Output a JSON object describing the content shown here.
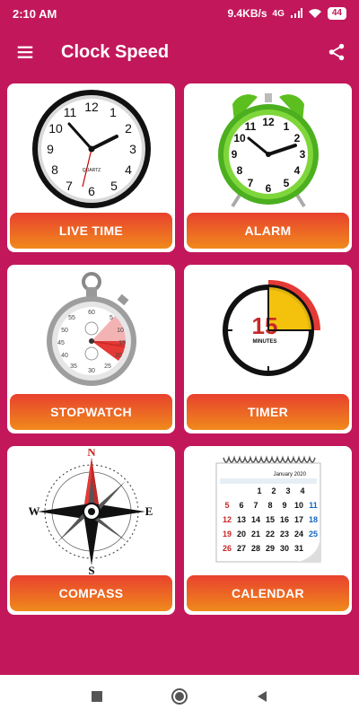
{
  "status": {
    "time": "2:10 AM",
    "speed": "9.4KB/s",
    "network": "4G",
    "battery": "44"
  },
  "app_bar": {
    "title": "Clock Speed",
    "menu_icon": "hamburger-menu-icon",
    "share_icon": "share-icon"
  },
  "cards": [
    {
      "label": "LIVE TIME",
      "icon": "wall-clock-icon"
    },
    {
      "label": "ALARM",
      "icon": "alarm-clock-icon"
    },
    {
      "label": "STOPWATCH",
      "icon": "stopwatch-icon"
    },
    {
      "label": "TIMER",
      "icon": "timer-icon"
    },
    {
      "label": "COMPASS",
      "icon": "compass-icon"
    },
    {
      "label": "CALENDAR",
      "icon": "calendar-icon"
    }
  ],
  "images": {
    "clock_numbers": [
      "12",
      "1",
      "2",
      "3",
      "4",
      "5",
      "6",
      "7",
      "8",
      "9",
      "10",
      "11"
    ],
    "clock_brand": "QUARTZ",
    "timer_number": "15",
    "timer_unit": "MINUTES",
    "compass_letters": {
      "n": "N",
      "e": "E",
      "s": "S",
      "w": "W"
    },
    "calendar_month": "January 2020"
  },
  "nav": {
    "back_icon": "back-triangle-icon",
    "home_icon": "home-circle-icon",
    "recents_icon": "recents-square-icon"
  },
  "colors": {
    "background": "#c2185b",
    "button_top": "#e8412e",
    "button_bottom": "#f08a1c"
  }
}
